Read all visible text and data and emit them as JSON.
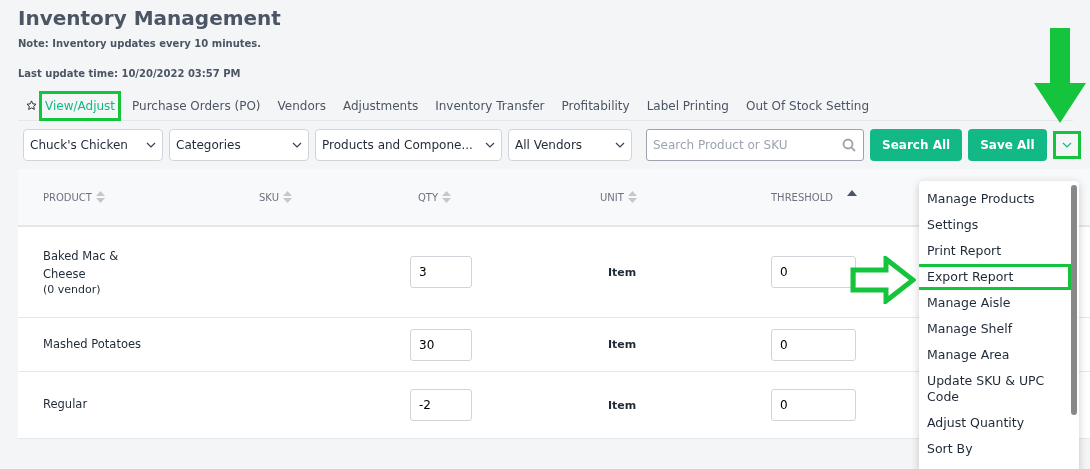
{
  "title": "Inventory Management",
  "note": "Note: Inventory updates every 10 minutes.",
  "last_update": "Last update time: 10/20/2022 03:57 PM",
  "tabs": [
    {
      "label": "View/Adjust",
      "selected": true,
      "highlighted": true
    },
    {
      "label": "Purchase Orders (PO)",
      "selected": false,
      "highlighted": false
    },
    {
      "label": "Vendors",
      "selected": false,
      "highlighted": false
    },
    {
      "label": "Adjustments",
      "selected": false,
      "highlighted": false
    },
    {
      "label": "Inventory Transfer",
      "selected": false,
      "highlighted": false
    },
    {
      "label": "Profitability",
      "selected": false,
      "highlighted": false
    },
    {
      "label": "Label Printing",
      "selected": false,
      "highlighted": false
    },
    {
      "label": "Out Of Stock Setting",
      "selected": false,
      "highlighted": false
    }
  ],
  "filters": [
    {
      "value": "Chuck's Chicken"
    },
    {
      "value": "Categories"
    },
    {
      "value": "Products and Compone..."
    },
    {
      "value": "All Vendors"
    }
  ],
  "search": {
    "placeholder": "Search Product or SKU"
  },
  "buttons": [
    "Search All",
    "Save All"
  ],
  "more_toggle": {
    "highlighted": true
  },
  "table": {
    "columns": [
      {
        "label": "PRODUCT",
        "sorted_ascending": false
      },
      {
        "label": "SKU",
        "sorted_ascending": false
      },
      {
        "label": "QTY",
        "sorted_ascending": false
      },
      {
        "label": "UNIT",
        "sorted_ascending": false
      },
      {
        "label": "THRESHOLD",
        "sorted_ascending": true
      }
    ],
    "rows": [
      {
        "product": "Baked Mac & Cheese",
        "sub": "(0 vendor)",
        "qty": "3",
        "unit": "Item",
        "threshold": "0"
      },
      {
        "product": "Mashed Potatoes",
        "qty": "30",
        "unit": "Item",
        "threshold": "0"
      },
      {
        "product": "Regular",
        "qty": "-2",
        "unit": "Item",
        "threshold": "0"
      }
    ]
  },
  "menu": [
    {
      "label": "Manage Products",
      "highlighted": false
    },
    {
      "label": "Settings",
      "highlighted": false
    },
    {
      "label": "Print Report",
      "highlighted": false
    },
    {
      "label": "Export Report",
      "highlighted": true
    },
    {
      "label": "Manage Aisle",
      "highlighted": false
    },
    {
      "label": "Manage Shelf",
      "highlighted": false
    },
    {
      "label": "Manage Area",
      "highlighted": false
    },
    {
      "label": "Update SKU & UPC Code",
      "highlighted": false
    },
    {
      "label": "Adjust Quantity",
      "highlighted": false
    },
    {
      "label": "Sort By",
      "highlighted": false
    }
  ]
}
